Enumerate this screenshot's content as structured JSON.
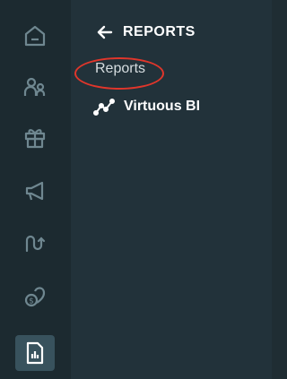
{
  "colors": {
    "rail_bg": "#1c2a30",
    "panel_bg": "#22323a",
    "icon_color": "#6f8790",
    "active_bg": "#38525d",
    "highlight": "#e0362b"
  },
  "rail": {
    "items": [
      {
        "icon": "home-icon"
      },
      {
        "icon": "people-icon"
      },
      {
        "icon": "gift-icon"
      },
      {
        "icon": "megaphone-icon"
      },
      {
        "icon": "journey-icon"
      },
      {
        "icon": "donation-icon"
      },
      {
        "icon": "report-icon",
        "active": true
      }
    ]
  },
  "panel": {
    "back": {
      "icon": "arrow-left-icon",
      "label": "REPORTS"
    },
    "menu_item": {
      "label": "Reports"
    },
    "sub_item": {
      "icon": "chart-line-icon",
      "label": "Virtuous BI"
    }
  }
}
